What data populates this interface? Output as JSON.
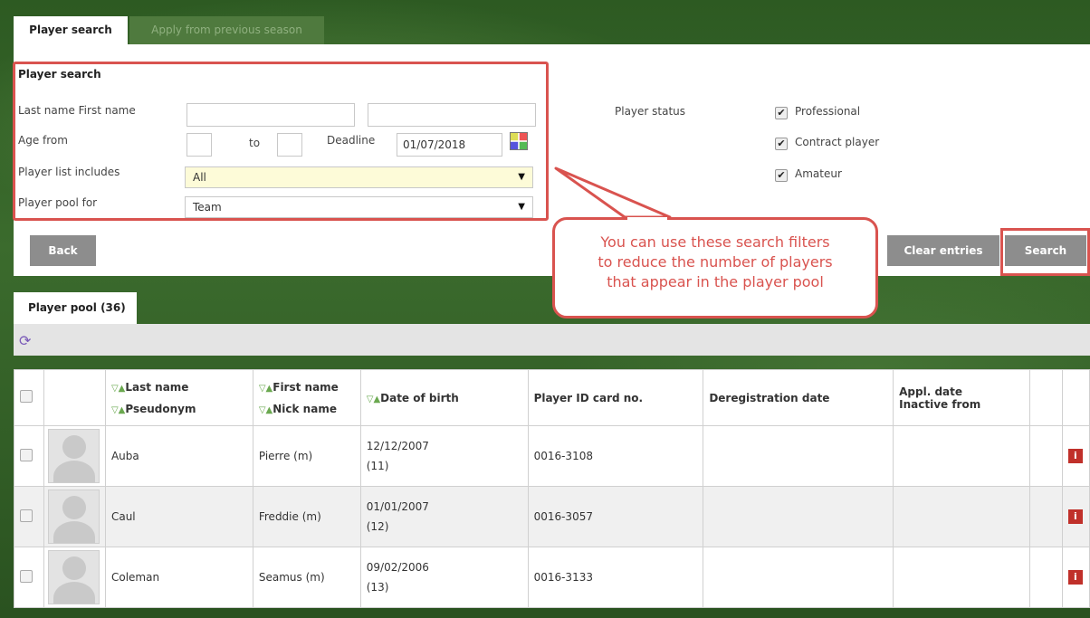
{
  "tabs": {
    "active": "Player search",
    "inactive": "Apply from previous season"
  },
  "search": {
    "title": "Player search",
    "last_first_label": "Last name  First name",
    "last_name_value": "",
    "first_name_value": "",
    "age_from_label": "Age from",
    "age_to_label": "to",
    "age_from_value": "",
    "age_to_value": "",
    "deadline_label": "Deadline",
    "deadline_value": "01/07/2018",
    "list_includes_label": "Player list includes",
    "list_includes_value": "All",
    "pool_for_label": "Player pool for",
    "pool_for_value": "Team",
    "status_label": "Player status",
    "status_options": [
      {
        "label": "Professional",
        "checked": true
      },
      {
        "label": "Contract player",
        "checked": true
      },
      {
        "label": "Amateur",
        "checked": true
      }
    ],
    "back_label": "Back",
    "clear_label": "Clear entries",
    "search_label": "Search"
  },
  "callout": {
    "line1": "You can use these search filters",
    "line2": "to reduce the number of players",
    "line3": "that appear in the player pool"
  },
  "pool": {
    "tab_label": "Player pool (36)",
    "headers": {
      "last_name": "Last name",
      "pseudonym": "Pseudonym",
      "first_name": "First name",
      "nick_name": "Nick name",
      "dob": "Date of birth",
      "id_card": "Player ID card no.",
      "dereg": "Deregistration date",
      "appl_date": "Appl. date",
      "inactive_from": "Inactive from"
    },
    "rows": [
      {
        "last": "Auba",
        "first": "Pierre (m)",
        "dob": "12/12/2007",
        "age": "(11)",
        "id": "0016-3108"
      },
      {
        "last": "Caul",
        "first": "Freddie (m)",
        "dob": "01/01/2007",
        "age": "(12)",
        "id": "0016-3057"
      },
      {
        "last": "Coleman",
        "first": "Seamus (m)",
        "dob": "09/02/2006",
        "age": "(13)",
        "id": "0016-3133"
      }
    ]
  },
  "colors": {
    "highlight": "#d9534f",
    "button": "#8d8d8d",
    "background": "#2f5a25"
  },
  "icons": {
    "sort": "sort-arrows-icon",
    "calendar": "calendar-icon",
    "refresh": "refresh-icon",
    "info": "info-icon"
  }
}
